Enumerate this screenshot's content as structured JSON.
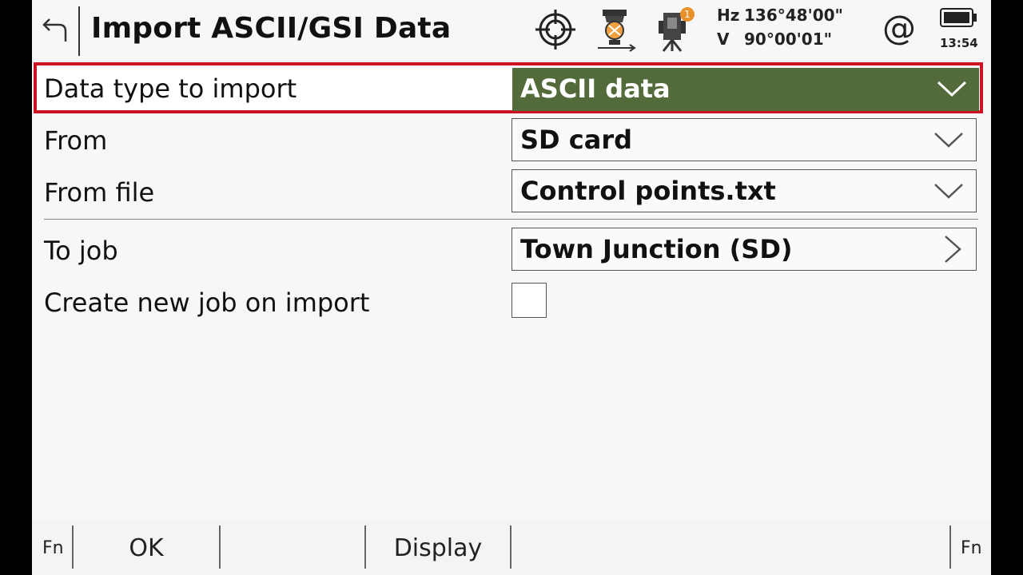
{
  "header": {
    "title": "Import ASCII/GSI Data",
    "hz_label": "Hz",
    "hz_value": "136°48'00\"",
    "v_label": "V",
    "v_value": "90°00'01\"",
    "time": "13:54",
    "badge_count": "1",
    "icons": [
      "back-arrow-icon",
      "target-crosshair-icon",
      "prism-pole-icon",
      "total-station-icon",
      "at-sign-icon",
      "battery-icon"
    ]
  },
  "form": {
    "data_type": {
      "label": "Data type to import",
      "value": "ASCII data"
    },
    "from": {
      "label": "From",
      "value": "SD card"
    },
    "from_file": {
      "label": "From file",
      "value": "Control points.txt"
    },
    "to_job": {
      "label": "To job",
      "value": "Town Junction (SD)"
    },
    "create_new_job": {
      "label": "Create new job on import",
      "checked": false
    }
  },
  "softkeys": {
    "fn_left": "Fn",
    "ok": "OK",
    "display": "Display",
    "fn_right": "Fn"
  },
  "colors": {
    "selected_field_bg": "#536b3a",
    "highlight_border": "#cc1122",
    "badge": "#e8902a"
  }
}
